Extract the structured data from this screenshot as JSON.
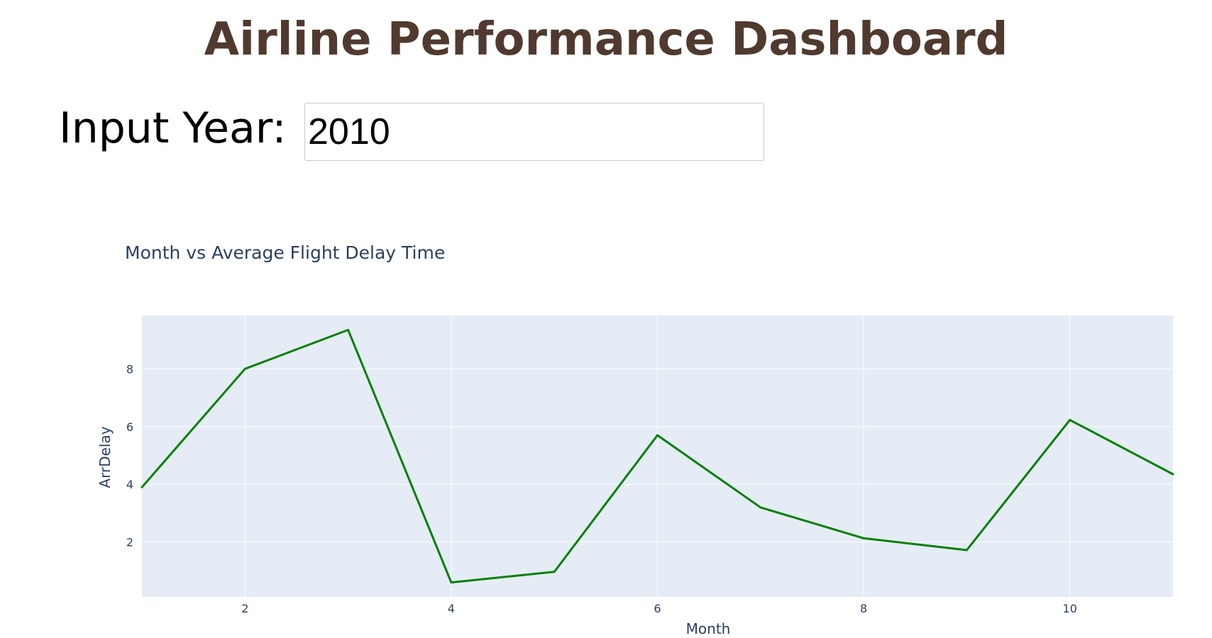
{
  "header": {
    "title": "Airline Performance Dashboard",
    "title_color": "#503A2F"
  },
  "year_input": {
    "label": "Input Year:",
    "value": "2010"
  },
  "chart_data": {
    "type": "line",
    "title": "Month vs Average Flight Delay Time",
    "xlabel": "Month",
    "ylabel": "ArrDelay",
    "x": [
      1,
      2,
      3,
      4,
      5,
      6,
      7,
      8,
      9,
      10,
      11
    ],
    "series": [
      {
        "values": [
          3.9,
          8.0,
          9.35,
          0.6,
          0.97,
          5.7,
          3.2,
          2.13,
          1.72,
          6.23,
          4.35
        ]
      }
    ],
    "xlim": [
      1,
      11
    ],
    "ylim": [
      0.1,
      9.85
    ],
    "xticks": [
      2,
      4,
      6,
      8,
      10
    ],
    "yticks": [
      2,
      4,
      6,
      8
    ],
    "grid": true,
    "line_color": "#008000",
    "plot_bg": "#E5ECF6",
    "grid_color": "#FFFFFF",
    "text_color": "#2A3F5F"
  }
}
